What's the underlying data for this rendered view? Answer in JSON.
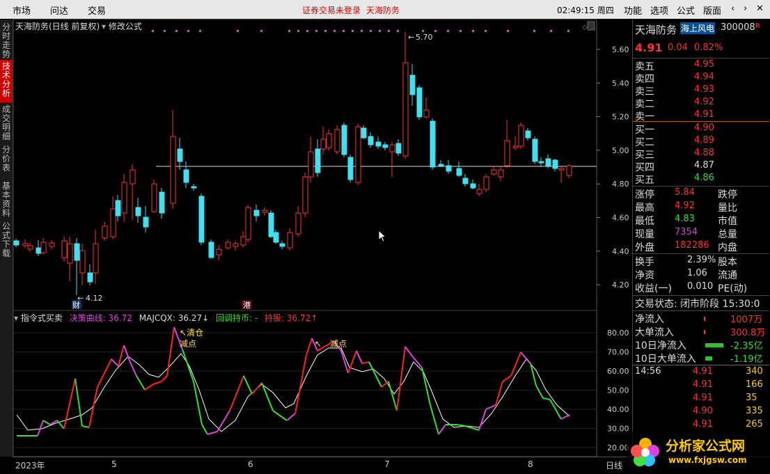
{
  "menu": {
    "items": [
      "市场",
      "问达",
      "交易"
    ],
    "notice": "证券交易未登录",
    "stock_name": "天海防务",
    "clock": "02:49:15 周四",
    "right_items": [
      "功能",
      "选项",
      "公式",
      "版面"
    ]
  },
  "sidebar": {
    "tabs": [
      {
        "label": "分时走势",
        "active": false
      },
      {
        "label": "技术分析",
        "active": true
      },
      {
        "label": "成交明细",
        "active": false
      },
      {
        "label": "分价表",
        "active": false
      },
      {
        "label": "基本资料",
        "active": false
      },
      {
        "label": "公式下载",
        "active": false
      }
    ]
  },
  "main_chart": {
    "title": "天海防务(日线 前复权)",
    "edit_label": "修改公式",
    "y_ticks": [
      "5.60",
      "5.40",
      "5.20",
      "5.00",
      "4.80",
      "4.60",
      "4.40",
      "4.20"
    ],
    "high_label": "5.70",
    "low_label": "4.12",
    "marker_cai": "财",
    "marker_gang": "港"
  },
  "indicator": {
    "name": "指令式买卖",
    "line1_label": "决策曲线: 36.72",
    "line2_label": "MAJCQX: 36.27",
    "line3_label": "回调持币: -",
    "line4_label": "持股: 36.72",
    "annot_clear": "清仓",
    "annot_reduce1": "减点",
    "annot_reduce2": "减点",
    "y_ticks": [
      "80.00",
      "70.00",
      "60.00",
      "50.00",
      "40.00",
      "30.00",
      "20.00"
    ]
  },
  "x_axis": {
    "labels": [
      "2023年",
      "5",
      "6",
      "7",
      "8"
    ],
    "period": "日线"
  },
  "quote": {
    "name": "天海防务",
    "sector": "海上风电",
    "code": "300008",
    "r_badge": "R",
    "price": "4.91",
    "change": "0.04",
    "pct": "0.82%",
    "asks": [
      {
        "label": "卖五",
        "price": "4.95"
      },
      {
        "label": "卖四",
        "price": "4.94"
      },
      {
        "label": "卖三",
        "price": "4.93"
      },
      {
        "label": "卖二",
        "price": "4.92"
      },
      {
        "label": "卖一",
        "price": "4.91"
      }
    ],
    "bids": [
      {
        "label": "买一",
        "price": "4.90"
      },
      {
        "label": "买二",
        "price": "4.89"
      },
      {
        "label": "买三",
        "price": "4.88"
      },
      {
        "label": "买四",
        "price": "4.87"
      },
      {
        "label": "买五",
        "price": "4.86"
      }
    ],
    "stats": [
      {
        "k": "涨停",
        "v": "5.84",
        "k2": "跌停"
      },
      {
        "k": "最高",
        "v": "4.92",
        "k2": "量比"
      },
      {
        "k": "最低",
        "v": "4.83",
        "k2": "市值"
      },
      {
        "k": "现量",
        "v": "7354",
        "k2": "总量"
      },
      {
        "k": "外盘",
        "v": "182286",
        "k2": "内盘"
      }
    ],
    "stats2": [
      {
        "k": "换手",
        "v": "2.39%",
        "k2": "股本"
      },
      {
        "k": "净资",
        "v": "1.06",
        "k2": "流通"
      },
      {
        "k": "收益(一)",
        "v": "0.010",
        "k2": "PE(动)"
      }
    ],
    "trade_status": "交易状态: 闭市阶段 15:30:0",
    "flows": [
      {
        "k": "净流入",
        "v": "1007万"
      },
      {
        "k": "大单流入",
        "v": "300.8万"
      },
      {
        "k": "10日净流入",
        "v": "-2.35亿"
      },
      {
        "k": "10日大单流入",
        "v": "-1.19亿"
      }
    ],
    "ticks": [
      {
        "t": "14:56",
        "p": "4.91",
        "v": "340"
      },
      {
        "t": "",
        "p": "4.91",
        "v": "166"
      },
      {
        "t": "",
        "p": "4.91",
        "v": "35"
      },
      {
        "t": "",
        "p": "4.90",
        "v": "335"
      },
      {
        "t": "",
        "p": "4.91",
        "v": "265"
      }
    ]
  },
  "watermark": {
    "brand": "分析家公式网",
    "url": "www.fxjgsw.com"
  }
}
